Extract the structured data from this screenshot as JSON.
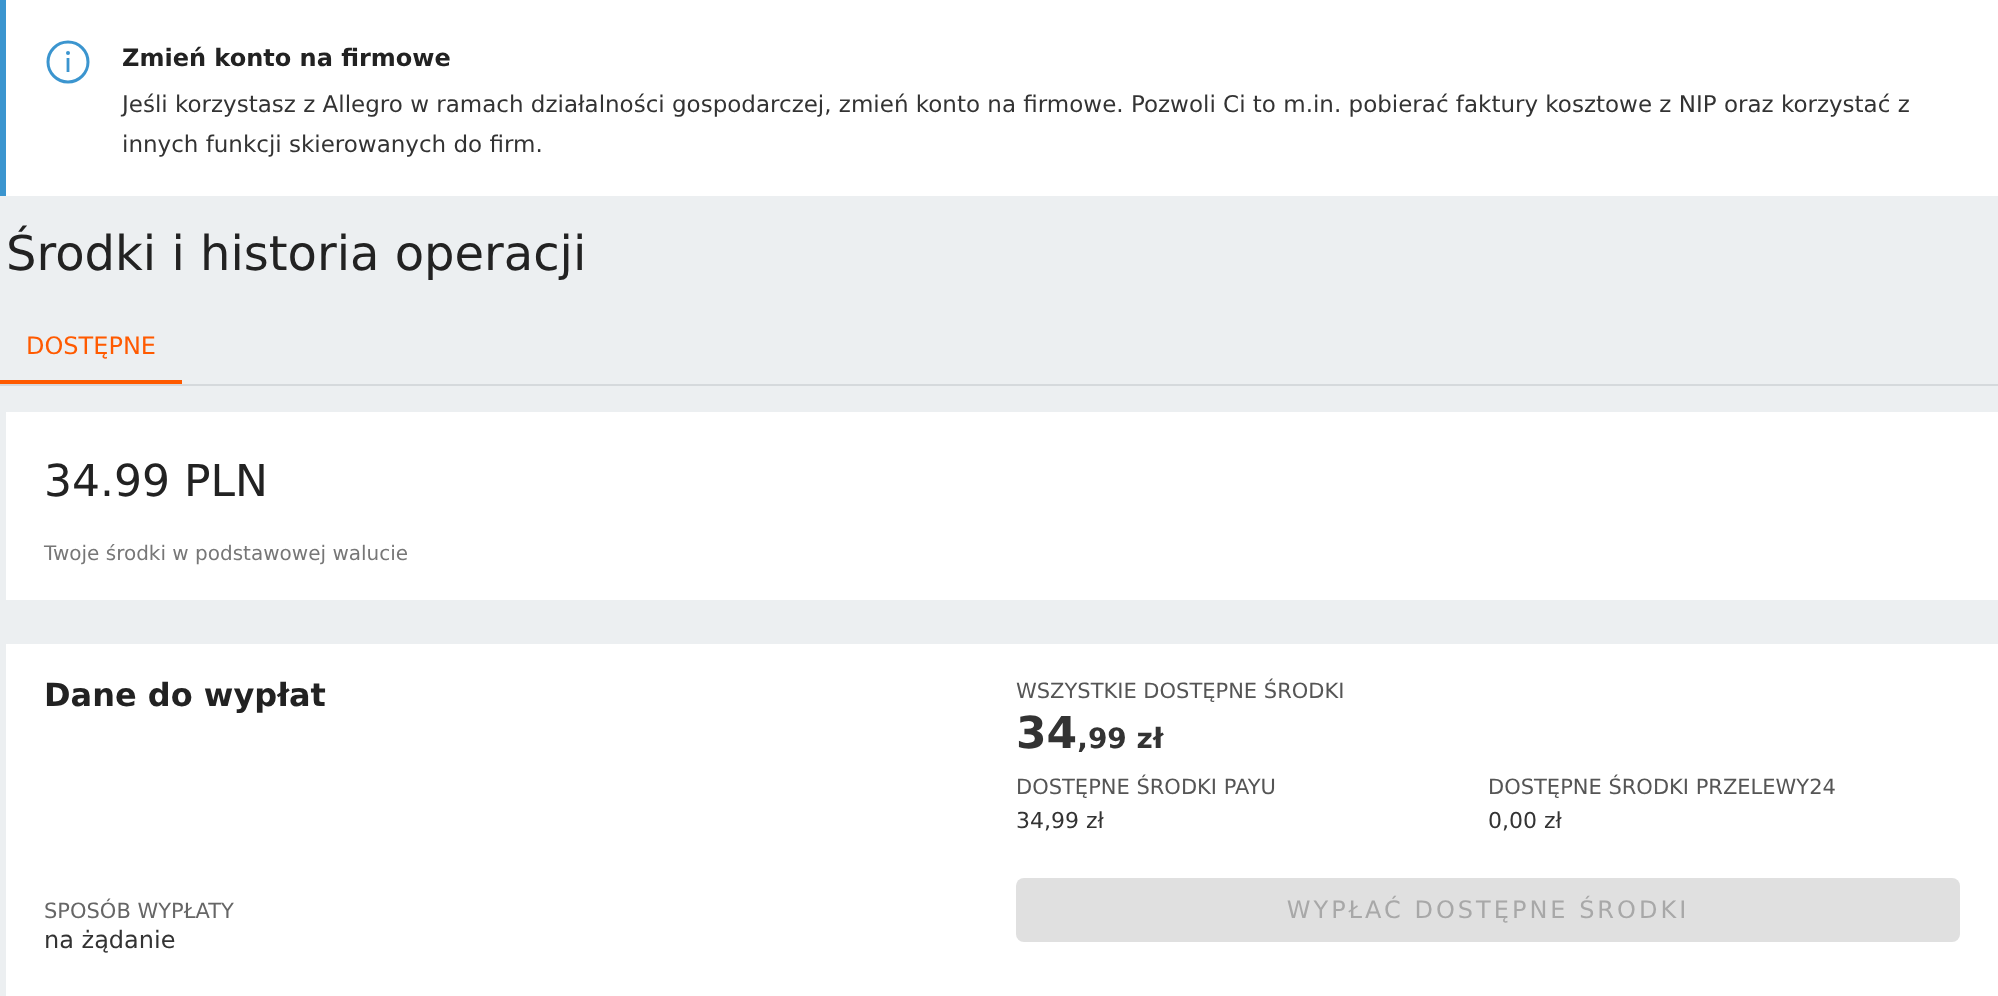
{
  "notice": {
    "title": "Zmień konto na firmowe",
    "text": "Jeśli korzystasz z Allegro w ramach działalności gospodarczej, zmień konto na firmowe. Pozwoli Ci to m.in. pobierać faktury kosztowe z NIP oraz korzystać z innych funkcji skierowanych do firm."
  },
  "page_title": "Środki i historia operacji",
  "tabs": [
    {
      "label": "DOSTĘPNE",
      "selected": true
    }
  ],
  "balance": {
    "amount": "34.99 PLN",
    "caption": "Twoje środki w podstawowej walucie"
  },
  "payout": {
    "title": "Dane do wypłat",
    "total_label": "WSZYSTKIE DOSTĘPNE ŚRODKI",
    "total_integer": "34",
    "total_fraction": ",99 zł",
    "sources": [
      {
        "label": "DOSTĘPNE ŚRODKI PAYU",
        "value": "34,99 zł"
      },
      {
        "label": "DOSTĘPNE ŚRODKI PRZELEWY24",
        "value": "0,00 zł"
      }
    ],
    "button": {
      "label": "WYPŁAĆ DOSTĘPNE ŚRODKI",
      "disabled": true
    },
    "method_label": "SPOSÓB WYPŁATY",
    "method_value": "na żądanie"
  }
}
